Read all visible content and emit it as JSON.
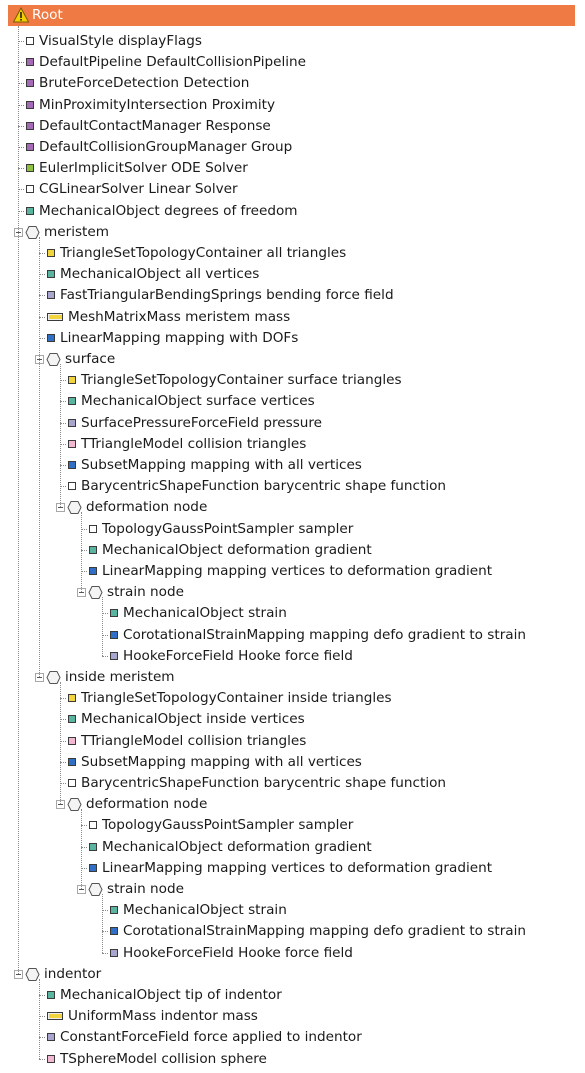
{
  "window": {
    "root_label": "Root"
  },
  "colors": {
    "header_bg": "#f07a43",
    "white": "#ffffff",
    "purple": "#a46ab5",
    "green": "#8cc240",
    "teal": "#5ab5a0",
    "yellow": "#f2d53c",
    "lavender": "#a8a6cf",
    "blue": "#2f6fc6",
    "pink": "#f2b8d2"
  },
  "tree_items": [
    {
      "kind": "component",
      "icon": "white",
      "type": "VisualStyle",
      "name": "displayFlags"
    },
    {
      "kind": "component",
      "icon": "purple",
      "type": "DefaultPipeline",
      "name": "DefaultCollisionPipeline"
    },
    {
      "kind": "component",
      "icon": "purple",
      "type": "BruteForceDetection",
      "name": "Detection"
    },
    {
      "kind": "component",
      "icon": "purple",
      "type": "MinProximityIntersection",
      "name": "Proximity"
    },
    {
      "kind": "component",
      "icon": "purple",
      "type": "DefaultContactManager",
      "name": "Response"
    },
    {
      "kind": "component",
      "icon": "purple",
      "type": "DefaultCollisionGroupManager",
      "name": "Group"
    },
    {
      "kind": "component",
      "icon": "green",
      "type": "EulerImplicitSolver",
      "name": "ODE Solver"
    },
    {
      "kind": "component",
      "icon": "white",
      "type": "CGLinearSolver",
      "name": "Linear Solver"
    },
    {
      "kind": "component",
      "icon": "teal",
      "type": "MechanicalObject",
      "name": "degrees of freedom"
    },
    {
      "kind": "node",
      "name": "meristem"
    },
    {
      "kind": "component",
      "icon": "yellow",
      "type": "TriangleSetTopologyContainer",
      "name": "all triangles"
    },
    {
      "kind": "component",
      "icon": "teal",
      "type": "MechanicalObject",
      "name": "all vertices"
    },
    {
      "kind": "component",
      "icon": "lavender",
      "type": "FastTriangularBendingSprings",
      "name": "bending force field"
    },
    {
      "kind": "component",
      "icon": "mass",
      "type": "MeshMatrixMass",
      "name": "meristem mass"
    },
    {
      "kind": "component",
      "icon": "blue",
      "type": "LinearMapping",
      "name": "mapping with DOFs"
    },
    {
      "kind": "node",
      "name": "surface"
    },
    {
      "kind": "component",
      "icon": "yellow",
      "type": "TriangleSetTopologyContainer",
      "name": "surface triangles"
    },
    {
      "kind": "component",
      "icon": "teal",
      "type": "MechanicalObject",
      "name": "surface vertices"
    },
    {
      "kind": "component",
      "icon": "lavender",
      "type": "SurfacePressureForceField",
      "name": "pressure"
    },
    {
      "kind": "component",
      "icon": "pink",
      "type": "TTriangleModel",
      "name": "collision triangles"
    },
    {
      "kind": "component",
      "icon": "blue",
      "type": "SubsetMapping",
      "name": "mapping with all vertices"
    },
    {
      "kind": "component",
      "icon": "white",
      "type": "BarycentricShapeFunction",
      "name": "barycentric shape function"
    },
    {
      "kind": "node",
      "name": "deformation node"
    },
    {
      "kind": "component",
      "icon": "white",
      "type": "TopologyGaussPointSampler",
      "name": "sampler"
    },
    {
      "kind": "component",
      "icon": "teal",
      "type": "MechanicalObject",
      "name": "deformation gradient"
    },
    {
      "kind": "component",
      "icon": "blue",
      "type": "LinearMapping",
      "name": "mapping vertices to deformation gradient"
    },
    {
      "kind": "node",
      "name": "strain node"
    },
    {
      "kind": "component",
      "icon": "teal",
      "type": "MechanicalObject",
      "name": "strain"
    },
    {
      "kind": "component",
      "icon": "blue",
      "type": "CorotationalStrainMapping",
      "name": "mapping defo gradient to strain"
    },
    {
      "kind": "component",
      "icon": "lavender",
      "type": "HookeForceField",
      "name": "Hooke force field"
    },
    {
      "kind": "node",
      "name": "inside meristem"
    },
    {
      "kind": "component",
      "icon": "yellow",
      "type": "TriangleSetTopologyContainer",
      "name": "inside triangles"
    },
    {
      "kind": "component",
      "icon": "teal",
      "type": "MechanicalObject",
      "name": "inside vertices"
    },
    {
      "kind": "component",
      "icon": "pink",
      "type": "TTriangleModel",
      "name": "collision triangles"
    },
    {
      "kind": "component",
      "icon": "blue",
      "type": "SubsetMapping",
      "name": "mapping with all vertices"
    },
    {
      "kind": "component",
      "icon": "white",
      "type": "BarycentricShapeFunction",
      "name": "barycentric shape function"
    },
    {
      "kind": "node",
      "name": "deformation node"
    },
    {
      "kind": "component",
      "icon": "white",
      "type": "TopologyGaussPointSampler",
      "name": "sampler"
    },
    {
      "kind": "component",
      "icon": "teal",
      "type": "MechanicalObject",
      "name": "deformation gradient"
    },
    {
      "kind": "component",
      "icon": "blue",
      "type": "LinearMapping",
      "name": "mapping vertices to deformation gradient"
    },
    {
      "kind": "node",
      "name": "strain node"
    },
    {
      "kind": "component",
      "icon": "teal",
      "type": "MechanicalObject",
      "name": "strain"
    },
    {
      "kind": "component",
      "icon": "blue",
      "type": "CorotationalStrainMapping",
      "name": "mapping defo gradient to strain"
    },
    {
      "kind": "component",
      "icon": "lavender",
      "type": "HookeForceField",
      "name": "Hooke force field"
    },
    {
      "kind": "node",
      "name": "indentor"
    },
    {
      "kind": "component",
      "icon": "teal",
      "type": "MechanicalObject",
      "name": "tip of indentor"
    },
    {
      "kind": "component",
      "icon": "mass",
      "type": "UniformMass",
      "name": "indentor mass"
    },
    {
      "kind": "component",
      "icon": "lavender",
      "type": "ConstantForceField",
      "name": "force applied to indentor"
    },
    {
      "kind": "component",
      "icon": "pink",
      "type": "TSphereModel",
      "name": "collision sphere"
    }
  ]
}
